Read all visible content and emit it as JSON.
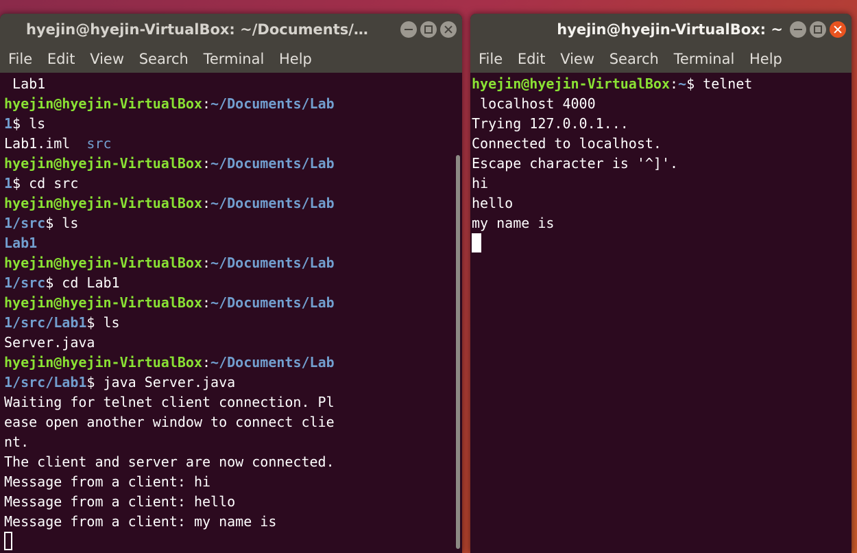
{
  "left_window": {
    "title": "hyejin@hyejin-VirtualBox: ~/Documents/…",
    "menu": [
      "File",
      "Edit",
      "View",
      "Search",
      "Terminal",
      "Help"
    ],
    "lines": [
      " Lab1",
      "hyejin@hyejin-VirtualBox:~/Documents/Lab",
      "1$ ls",
      "Lab1.iml  src",
      "hyejin@hyejin-VirtualBox:~/Documents/Lab",
      "1$ cd src",
      "hyejin@hyejin-VirtualBox:~/Documents/Lab",
      "1/src$ ls",
      "Lab1",
      "hyejin@hyejin-VirtualBox:~/Documents/Lab",
      "1/src$ cd Lab1",
      "hyejin@hyejin-VirtualBox:~/Documents/Lab",
      "1/src/Lab1$ ls",
      "Server.java",
      "hyejin@hyejin-VirtualBox:~/Documents/Lab",
      "1/src/Lab1$ java Server.java",
      "Waiting for telnet client connection. Pl",
      "ease open another window to connect clie",
      "nt.",
      "The client and server are now connected.",
      "Message from a client: hi",
      "Message from a client: hello",
      "Message from a client: my name is"
    ]
  },
  "right_window": {
    "title": "hyejin@hyejin-VirtualBox: ~",
    "menu": [
      "File",
      "Edit",
      "View",
      "Search",
      "Terminal",
      "Help"
    ],
    "lines": [
      "hyejin@hyejin-VirtualBox:~$ telnet",
      " localhost 4000",
      "Trying 127.0.0.1...",
      "Connected to localhost.",
      "Escape character is '^]'.",
      "hi",
      "hello",
      "my name is"
    ]
  },
  "colors": {
    "terminal_bg": "#2c0a1f",
    "prompt_user": "#8ae234",
    "prompt_path": "#729fcf",
    "titlebar": "#45423c",
    "close_active": "#e95420"
  }
}
